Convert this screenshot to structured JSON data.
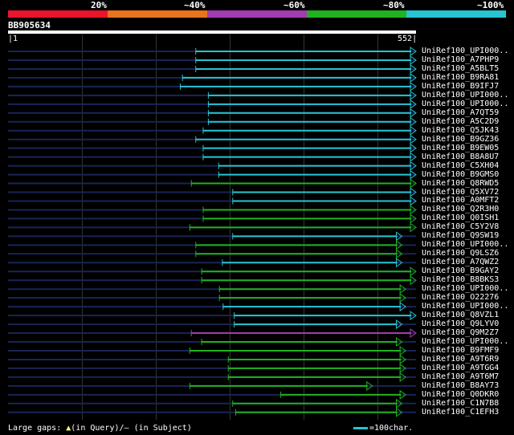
{
  "identity_scale": {
    "labels": [
      "20%",
      "~40%",
      "~60%",
      "~80%",
      "~100%"
    ],
    "colors": [
      "#e8152b",
      "#e8741b",
      "#a43bb0",
      "#20b21f",
      "#27c4d2"
    ]
  },
  "query": {
    "id": "BB905634",
    "start_label": "1",
    "end_label": "552",
    "length": 552
  },
  "colors": {
    "cyan": "#27c4d2",
    "green": "#20b21f",
    "purple": "#a43bb0",
    "thin": "#182555",
    "text": "#ffffff",
    "marker": "#ffff66"
  },
  "hits": [
    {
      "label": "UniRef100_UPI000..",
      "start": 254,
      "end": 552,
      "color": "cyan"
    },
    {
      "label": "UniRef100_A7PHP9",
      "start": 254,
      "end": 552,
      "color": "cyan"
    },
    {
      "label": "UniRef100_A5BLT5",
      "start": 254,
      "end": 552,
      "color": "cyan"
    },
    {
      "label": "UniRef100_B9RA81",
      "start": 236,
      "end": 552,
      "color": "cyan"
    },
    {
      "label": "UniRef100_B9IFJ7",
      "start": 233,
      "end": 552,
      "color": "cyan"
    },
    {
      "label": "UniRef100_UPI000..",
      "start": 271,
      "end": 552,
      "color": "cyan"
    },
    {
      "label": "UniRef100_UPI000..",
      "start": 271,
      "end": 552,
      "color": "cyan"
    },
    {
      "label": "UniRef100_A7QT59",
      "start": 271,
      "end": 552,
      "color": "cyan"
    },
    {
      "label": "UniRef100_A5C2D9",
      "start": 271,
      "end": 552,
      "color": "cyan"
    },
    {
      "label": "UniRef100_Q5JK43",
      "start": 264,
      "end": 552,
      "color": "cyan"
    },
    {
      "label": "UniRef100_B9GZ36",
      "start": 254,
      "end": 552,
      "color": "cyan"
    },
    {
      "label": "UniRef100_B9EW05",
      "start": 264,
      "end": 552,
      "color": "cyan"
    },
    {
      "label": "UniRef100_B8A8U7",
      "start": 264,
      "end": 552,
      "color": "cyan"
    },
    {
      "label": "UniRef100_C5XH04",
      "start": 285,
      "end": 552,
      "color": "cyan"
    },
    {
      "label": "UniRef100_B9GMS0",
      "start": 285,
      "end": 552,
      "color": "cyan"
    },
    {
      "label": "UniRef100_Q8RWD5",
      "start": 248,
      "end": 552,
      "color": "green"
    },
    {
      "label": "UniRef100_Q5XV72",
      "start": 304,
      "end": 552,
      "color": "cyan"
    },
    {
      "label": "UniRef100_A0MFT2",
      "start": 304,
      "end": 552,
      "color": "cyan"
    },
    {
      "label": "UniRef100_Q2R3H0",
      "start": 264,
      "end": 552,
      "color": "green"
    },
    {
      "label": "UniRef100_Q0ISH1",
      "start": 264,
      "end": 552,
      "color": "green"
    },
    {
      "label": "UniRef100_C5Y2V8",
      "start": 246,
      "end": 552,
      "color": "green"
    },
    {
      "label": "UniRef100_Q9SW19",
      "start": 304,
      "end": 533,
      "color": "cyan"
    },
    {
      "label": "UniRef100_UPI000..",
      "start": 254,
      "end": 533,
      "color": "green"
    },
    {
      "label": "UniRef100_Q9LSZ6",
      "start": 254,
      "end": 533,
      "color": "green"
    },
    {
      "label": "UniRef100_A7QWZ2",
      "start": 290,
      "end": 533,
      "color": "cyan"
    },
    {
      "label": "UniRef100_B9GAY2",
      "start": 262,
      "end": 552,
      "color": "green"
    },
    {
      "label": "UniRef100_B8BKS3",
      "start": 262,
      "end": 552,
      "color": "green"
    },
    {
      "label": "UniRef100_UPI000..",
      "start": 286,
      "end": 538,
      "color": "green"
    },
    {
      "label": "UniRef100_O22276",
      "start": 286,
      "end": 538,
      "color": "green"
    },
    {
      "label": "UniRef100_UPI000..",
      "start": 291,
      "end": 538,
      "color": "cyan"
    },
    {
      "label": "UniRef100_Q8VZL1",
      "start": 306,
      "end": 552,
      "color": "cyan"
    },
    {
      "label": "UniRef100_Q9LYV0",
      "start": 306,
      "end": 533,
      "color": "cyan"
    },
    {
      "label": "UniRef100_Q9M2Z7",
      "start": 248,
      "end": 552,
      "color": "purple"
    },
    {
      "label": "UniRef100_UPI000..",
      "start": 262,
      "end": 533,
      "color": "green"
    },
    {
      "label": "UniRef100_B9FMF9",
      "start": 246,
      "end": 538,
      "color": "green"
    },
    {
      "label": "UniRef100_A9T6R9",
      "start": 298,
      "end": 538,
      "color": "green"
    },
    {
      "label": "UniRef100_A9TGG4",
      "start": 298,
      "end": 538,
      "color": "green"
    },
    {
      "label": "UniRef100_A9T6M7",
      "start": 298,
      "end": 538,
      "color": "green"
    },
    {
      "label": "UniRef100_B8AY73",
      "start": 246,
      "end": 493,
      "color": "green"
    },
    {
      "label": "UniRef100_Q0DKR0",
      "start": 369,
      "end": 538,
      "color": "green"
    },
    {
      "label": "UniRef100_C1N7B8",
      "start": 304,
      "end": 533,
      "color": "green"
    },
    {
      "label": "UniRef100_C1EFH3",
      "start": 308,
      "end": 533,
      "color": "green"
    }
  ],
  "legend": {
    "large_gaps_prefix": "Large gaps: ",
    "in_query": "(in Query)/",
    "dash": "–",
    "in_subject": " (in Subject)",
    "scale_text": "=100char."
  }
}
